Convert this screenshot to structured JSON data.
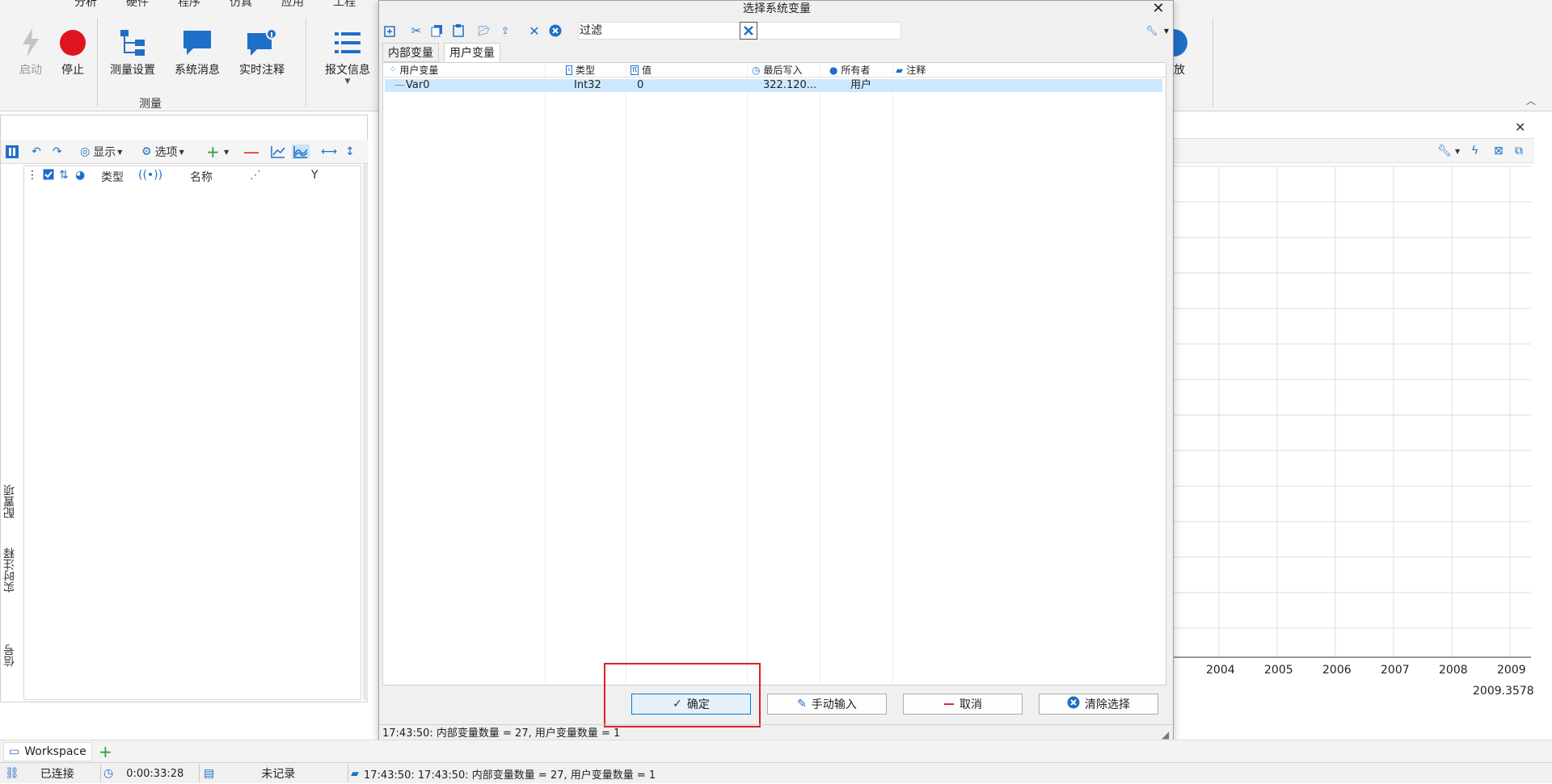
{
  "ribbon": {
    "tabs": [
      "分析",
      "硬件",
      "程序",
      "仿真",
      "应用",
      "工程"
    ],
    "buttons": {
      "start": "启动",
      "stop": "停止",
      "measure_settings": "测量设置",
      "system_messages": "系统消息",
      "realtime_annotation": "实时注释",
      "message_info": "报文信息",
      "playback": "回放"
    },
    "group_label": "测量"
  },
  "left_panel": {
    "toolbar": {
      "display": "显示",
      "options": "选项"
    },
    "columns": {
      "type": "类型",
      "name": "名称",
      "y": "Y"
    },
    "vertical_tabs": [
      "配置项",
      "实时注释",
      "信号"
    ]
  },
  "chart": {
    "x_ticks": [
      "2004",
      "2005",
      "2006",
      "2007",
      "2008",
      "2009"
    ],
    "cursor_value": "2009.3578"
  },
  "dialog": {
    "title": "选择系统变量",
    "filter_label": "过滤",
    "tabs": [
      "内部变量",
      "用户变量"
    ],
    "active_tab": 1,
    "columns": {
      "user_var": "用户变量",
      "type": "类型",
      "value": "值",
      "last_write": "最后写入",
      "owner": "所有者",
      "comment": "注释"
    },
    "rows": [
      {
        "name": "Var0",
        "type": "Int32",
        "value": "0",
        "last_write": "322.120...",
        "owner": "用户",
        "comment": ""
      }
    ],
    "buttons": {
      "ok": "确定",
      "manual_input": "手动输入",
      "cancel": "取消",
      "clear_selection": "清除选择"
    },
    "status": "17:43:50: 内部变量数量 = 27, 用户变量数量 = 1"
  },
  "workspace": {
    "tab_label": "Workspace"
  },
  "statusbar": {
    "connection": "已连接",
    "elapsed": "0:00:33:28",
    "recording": "未记录",
    "message": "17:43:50: 17:43:50: 内部变量数量 = 27, 用户变量数量 = 1"
  },
  "colors": {
    "accent": "#0078d4",
    "brand_blue": "#1e6fc8",
    "stop_red": "#e0141e",
    "selection": "#cce8ff",
    "highlight_box": "#e02020"
  }
}
